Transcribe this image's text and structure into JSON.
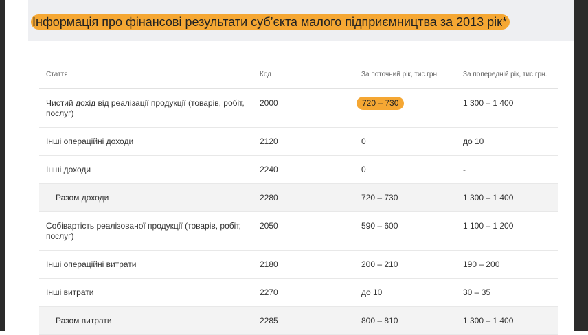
{
  "title": "Інформація про фінансові результати суб’єкта малого підприємництва за 2013 рік*",
  "table": {
    "headers": [
      "Стаття",
      "Код",
      "За поточний рік, тис.грн.",
      "За попередній рік, тис.грн."
    ],
    "rows": [
      {
        "name": "Чистий дохід від реалізації продукції (товарів, робіт, послуг)",
        "code": "2000",
        "current": "720 – 730",
        "previous": "1 300 – 1 400"
      },
      {
        "name": "Інші операційні доходи",
        "code": "2120",
        "current": "0",
        "previous": "до 10"
      },
      {
        "name": "Інші доходи",
        "code": "2240",
        "current": "0",
        "previous": "-"
      },
      {
        "name": "Разом доходи",
        "code": "2280",
        "current": "720 – 730",
        "previous": "1 300 – 1 400"
      },
      {
        "name": "Собівартість реалізованої продукції (товарів, робіт, послуг)",
        "code": "2050",
        "current": "590 – 600",
        "previous": "1 100 – 1 200"
      },
      {
        "name": "Інші операційні витрати",
        "code": "2180",
        "current": "200 – 210",
        "previous": "190 – 200"
      },
      {
        "name": "Інші витрати",
        "code": "2270",
        "current": "до 10",
        "previous": "30 – 35"
      },
      {
        "name": "Разом витрати",
        "code": "2285",
        "current": "800 – 810",
        "previous": "1 300 – 1 400"
      }
    ]
  },
  "colors": {
    "highlight": "#f5a733",
    "total_row": "#f3f3f3",
    "header_band": "#eeeff2",
    "side": "#2b2b2b"
  }
}
